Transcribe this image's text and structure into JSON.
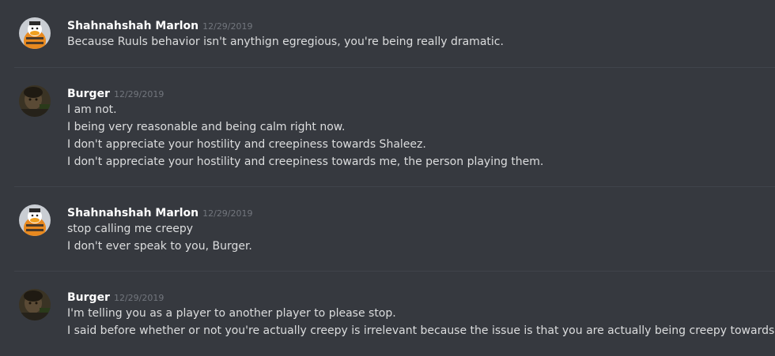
{
  "messages": [
    {
      "author": "Shahnahshah Marlon",
      "timestamp": "12/29/2019",
      "avatar": "duck-avatar",
      "lines": [
        "Because Ruuls behavior isn't anythign egregious, you're being really dramatic."
      ]
    },
    {
      "author": "Burger",
      "timestamp": "12/29/2019",
      "avatar": "photo-avatar",
      "lines": [
        "I am not.",
        "I being very reasonable and being calm right now.",
        "I don't appreciate your hostility and creepiness towards Shaleez.",
        "I don't appreciate your hostility and creepiness towards me, the person playing them."
      ]
    },
    {
      "author": "Shahnahshah Marlon",
      "timestamp": "12/29/2019",
      "avatar": "duck-avatar",
      "lines": [
        "stop calling me creepy",
        "I don't ever speak to you, Burger."
      ]
    },
    {
      "author": "Burger",
      "timestamp": "12/29/2019",
      "avatar": "photo-avatar",
      "lines": [
        "I'm telling you as a player to another player to please stop.",
        "I said before whether or not you're actually creepy is irrelevant because the issue is that you are actually being creepy towards them."
      ]
    }
  ],
  "colors": {
    "background": "#36393f",
    "username": "#ffffff",
    "timestamp": "#72767d",
    "message_text": "#dcddde",
    "divider": "#40444b"
  }
}
